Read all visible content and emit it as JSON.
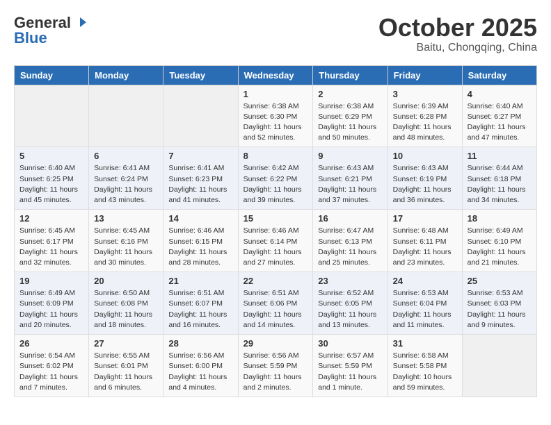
{
  "header": {
    "logo_general": "General",
    "logo_blue": "Blue",
    "month": "October 2025",
    "location": "Baitu, Chongqing, China"
  },
  "days_of_week": [
    "Sunday",
    "Monday",
    "Tuesday",
    "Wednesday",
    "Thursday",
    "Friday",
    "Saturday"
  ],
  "weeks": [
    [
      {
        "day": "",
        "info": ""
      },
      {
        "day": "",
        "info": ""
      },
      {
        "day": "",
        "info": ""
      },
      {
        "day": "1",
        "info": "Sunrise: 6:38 AM\nSunset: 6:30 PM\nDaylight: 11 hours\nand 52 minutes."
      },
      {
        "day": "2",
        "info": "Sunrise: 6:38 AM\nSunset: 6:29 PM\nDaylight: 11 hours\nand 50 minutes."
      },
      {
        "day": "3",
        "info": "Sunrise: 6:39 AM\nSunset: 6:28 PM\nDaylight: 11 hours\nand 48 minutes."
      },
      {
        "day": "4",
        "info": "Sunrise: 6:40 AM\nSunset: 6:27 PM\nDaylight: 11 hours\nand 47 minutes."
      }
    ],
    [
      {
        "day": "5",
        "info": "Sunrise: 6:40 AM\nSunset: 6:25 PM\nDaylight: 11 hours\nand 45 minutes."
      },
      {
        "day": "6",
        "info": "Sunrise: 6:41 AM\nSunset: 6:24 PM\nDaylight: 11 hours\nand 43 minutes."
      },
      {
        "day": "7",
        "info": "Sunrise: 6:41 AM\nSunset: 6:23 PM\nDaylight: 11 hours\nand 41 minutes."
      },
      {
        "day": "8",
        "info": "Sunrise: 6:42 AM\nSunset: 6:22 PM\nDaylight: 11 hours\nand 39 minutes."
      },
      {
        "day": "9",
        "info": "Sunrise: 6:43 AM\nSunset: 6:21 PM\nDaylight: 11 hours\nand 37 minutes."
      },
      {
        "day": "10",
        "info": "Sunrise: 6:43 AM\nSunset: 6:19 PM\nDaylight: 11 hours\nand 36 minutes."
      },
      {
        "day": "11",
        "info": "Sunrise: 6:44 AM\nSunset: 6:18 PM\nDaylight: 11 hours\nand 34 minutes."
      }
    ],
    [
      {
        "day": "12",
        "info": "Sunrise: 6:45 AM\nSunset: 6:17 PM\nDaylight: 11 hours\nand 32 minutes."
      },
      {
        "day": "13",
        "info": "Sunrise: 6:45 AM\nSunset: 6:16 PM\nDaylight: 11 hours\nand 30 minutes."
      },
      {
        "day": "14",
        "info": "Sunrise: 6:46 AM\nSunset: 6:15 PM\nDaylight: 11 hours\nand 28 minutes."
      },
      {
        "day": "15",
        "info": "Sunrise: 6:46 AM\nSunset: 6:14 PM\nDaylight: 11 hours\nand 27 minutes."
      },
      {
        "day": "16",
        "info": "Sunrise: 6:47 AM\nSunset: 6:13 PM\nDaylight: 11 hours\nand 25 minutes."
      },
      {
        "day": "17",
        "info": "Sunrise: 6:48 AM\nSunset: 6:11 PM\nDaylight: 11 hours\nand 23 minutes."
      },
      {
        "day": "18",
        "info": "Sunrise: 6:49 AM\nSunset: 6:10 PM\nDaylight: 11 hours\nand 21 minutes."
      }
    ],
    [
      {
        "day": "19",
        "info": "Sunrise: 6:49 AM\nSunset: 6:09 PM\nDaylight: 11 hours\nand 20 minutes."
      },
      {
        "day": "20",
        "info": "Sunrise: 6:50 AM\nSunset: 6:08 PM\nDaylight: 11 hours\nand 18 minutes."
      },
      {
        "day": "21",
        "info": "Sunrise: 6:51 AM\nSunset: 6:07 PM\nDaylight: 11 hours\nand 16 minutes."
      },
      {
        "day": "22",
        "info": "Sunrise: 6:51 AM\nSunset: 6:06 PM\nDaylight: 11 hours\nand 14 minutes."
      },
      {
        "day": "23",
        "info": "Sunrise: 6:52 AM\nSunset: 6:05 PM\nDaylight: 11 hours\nand 13 minutes."
      },
      {
        "day": "24",
        "info": "Sunrise: 6:53 AM\nSunset: 6:04 PM\nDaylight: 11 hours\nand 11 minutes."
      },
      {
        "day": "25",
        "info": "Sunrise: 6:53 AM\nSunset: 6:03 PM\nDaylight: 11 hours\nand 9 minutes."
      }
    ],
    [
      {
        "day": "26",
        "info": "Sunrise: 6:54 AM\nSunset: 6:02 PM\nDaylight: 11 hours\nand 7 minutes."
      },
      {
        "day": "27",
        "info": "Sunrise: 6:55 AM\nSunset: 6:01 PM\nDaylight: 11 hours\nand 6 minutes."
      },
      {
        "day": "28",
        "info": "Sunrise: 6:56 AM\nSunset: 6:00 PM\nDaylight: 11 hours\nand 4 minutes."
      },
      {
        "day": "29",
        "info": "Sunrise: 6:56 AM\nSunset: 5:59 PM\nDaylight: 11 hours\nand 2 minutes."
      },
      {
        "day": "30",
        "info": "Sunrise: 6:57 AM\nSunset: 5:59 PM\nDaylight: 11 hours\nand 1 minute."
      },
      {
        "day": "31",
        "info": "Sunrise: 6:58 AM\nSunset: 5:58 PM\nDaylight: 10 hours\nand 59 minutes."
      },
      {
        "day": "",
        "info": ""
      }
    ]
  ]
}
